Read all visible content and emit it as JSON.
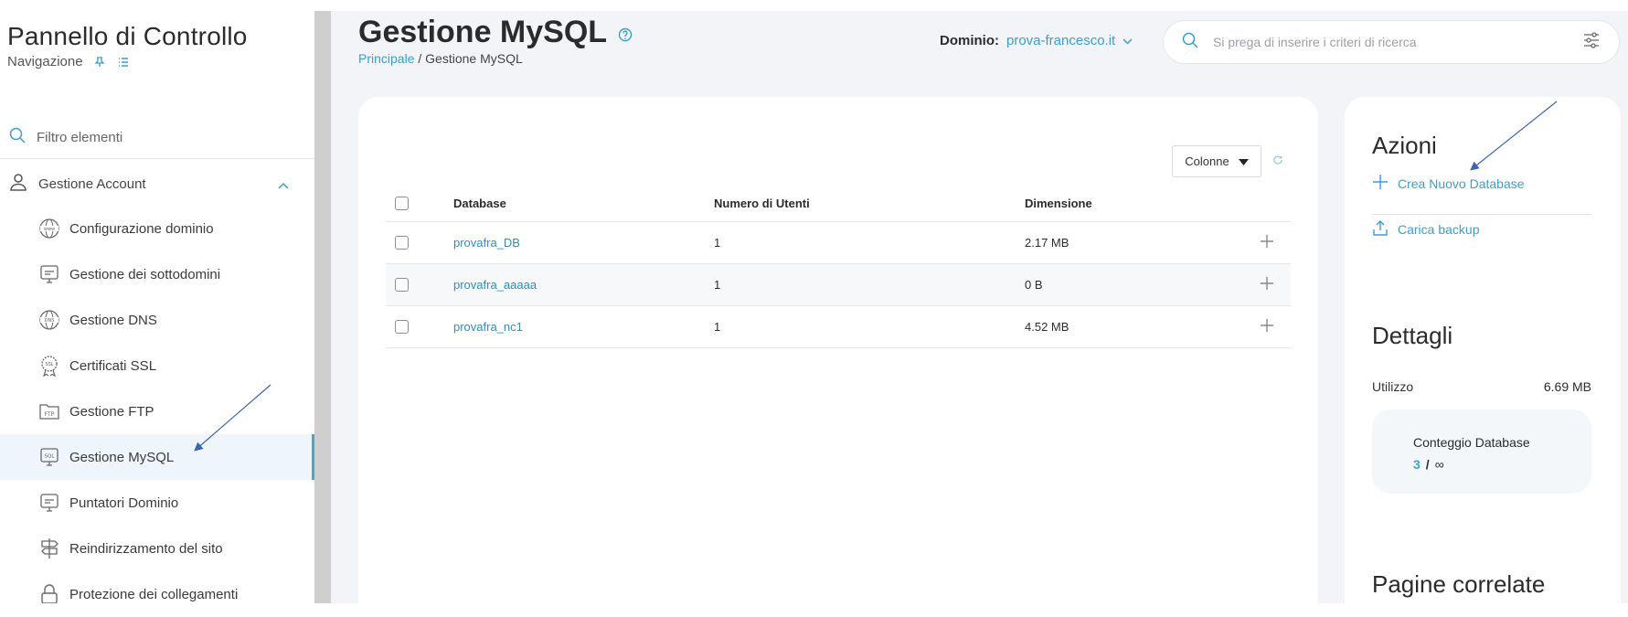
{
  "sidebar": {
    "title": "Pannello di Controllo",
    "subtitle": "Navigazione",
    "filter_placeholder": "Filtro elementi",
    "group_label": "Gestione Account",
    "items": [
      {
        "label": "Configurazione dominio",
        "icon": "www-globe-icon"
      },
      {
        "label": "Gestione dei sottodomini",
        "icon": "monitor-icon"
      },
      {
        "label": "Gestione DNS",
        "icon": "dns-globe-icon"
      },
      {
        "label": "Certificati SSL",
        "icon": "ssl-badge-icon"
      },
      {
        "label": "Gestione FTP",
        "icon": "ftp-folder-icon"
      },
      {
        "label": "Gestione MySQL",
        "icon": "sql-monitor-icon",
        "active": true
      },
      {
        "label": "Puntatori Dominio",
        "icon": "monitor-icon"
      },
      {
        "label": "Reindirizzamento del sito",
        "icon": "signpost-icon"
      },
      {
        "label": "Protezione dei collegamenti",
        "icon": "lock-icon"
      }
    ]
  },
  "header": {
    "title": "Gestione MySQL",
    "breadcrumb_home": "Principale",
    "breadcrumb_sep": " / ",
    "breadcrumb_current": "Gestione MySQL",
    "domain_label": "Dominio:",
    "domain_value": "prova-francesco.it",
    "search_placeholder": "Si prega di inserire i criteri di ricerca"
  },
  "table": {
    "columns_button": "Colonne",
    "headers": {
      "database": "Database",
      "users": "Numero di Utenti",
      "size": "Dimensione"
    },
    "rows": [
      {
        "database": "provafra_DB",
        "users": "1",
        "size": "2.17 MB"
      },
      {
        "database": "provafra_aaaaa",
        "users": "1",
        "size": "0 B"
      },
      {
        "database": "provafra_nc1",
        "users": "1",
        "size": "4.52 MB"
      }
    ]
  },
  "side": {
    "actions_title": "Azioni",
    "create_db": "Crea Nuovo Database",
    "upload_backup": "Carica backup",
    "details_title": "Dettagli",
    "usage_label": "Utilizzo",
    "usage_value": "6.69 MB",
    "count_label": "Conteggio Database",
    "count_used": "3",
    "count_sep": "/",
    "count_max": "∞",
    "related_title": "Pagine correlate"
  },
  "colors": {
    "accent": "#3a9fcb",
    "active_bg": "#eef6fb",
    "main_bg": "#f3f4f7"
  }
}
